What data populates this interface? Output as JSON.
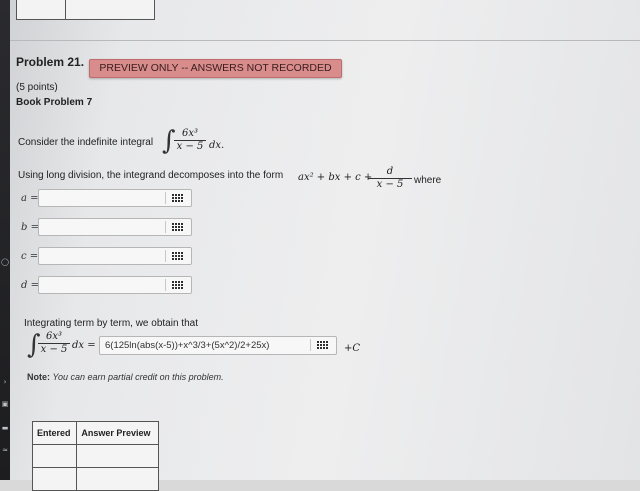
{
  "problem": {
    "title": "Problem 21.",
    "badge": "PREVIEW ONLY -- ANSWERS NOT RECORDED",
    "points": "(5 points)",
    "source": "Book Problem 7"
  },
  "question": {
    "intro": "Consider the indefinite integral",
    "integral_num": "6x³",
    "integral_den": "x − 5",
    "integral_dx": "dx.",
    "division_text": "Using long division, the integrand decomposes into the form",
    "form_poly": "ax² + bx + c +",
    "form_num": "d",
    "form_den": "x − 5",
    "form_where": "where"
  },
  "answers": [
    {
      "label": "a =",
      "value": ""
    },
    {
      "label": "b =",
      "value": ""
    },
    {
      "label": "c =",
      "value": ""
    },
    {
      "label": "d =",
      "value": ""
    }
  ],
  "integration": {
    "text": "Integrating term by term, we obtain that",
    "num": "6x³",
    "den": "x − 5",
    "dx_eq": "dx =",
    "answer_value": "6(125ln(abs(x-5))+x^3/3+(5x^2)/2+25x)",
    "plus_c": "+C"
  },
  "note": {
    "label": "Note:",
    "text": "You can earn partial credit on this problem."
  },
  "results_table": {
    "headers": [
      "Entered",
      "Answer Preview"
    ]
  },
  "icons": {
    "equation_editor": "equation-editor-icon"
  },
  "colors": {
    "badge_bg": "#d88c8c",
    "page_bg": "#eeeeef"
  }
}
